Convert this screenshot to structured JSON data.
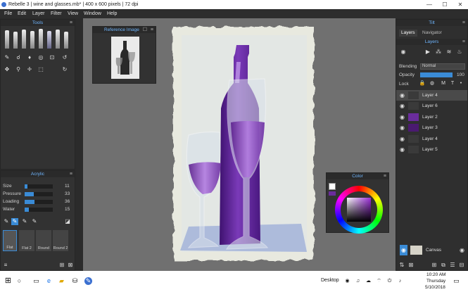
{
  "window": {
    "title": "Rebelle 3 | wine and glasses.mb* | 400 x 600 pixels | 72 dpi",
    "minimize": "—",
    "maximize": "☐",
    "close": "✕"
  },
  "menu": [
    "File",
    "Edit",
    "Layer",
    "Filter",
    "View",
    "Window",
    "Help"
  ],
  "tools_panel": {
    "title": "Tools"
  },
  "reference_panel": {
    "title": "Reference Image"
  },
  "acrylic_panel": {
    "title": "Acrylic",
    "params": [
      {
        "label": "Size",
        "value": "11",
        "level": 0.11
      },
      {
        "label": "Pressure",
        "value": "33",
        "level": 0.33
      },
      {
        "label": "Loading",
        "value": "36",
        "level": 0.36
      },
      {
        "label": "Water",
        "value": "15",
        "level": 0.15
      }
    ],
    "brushes": [
      "Flat",
      "Flat 2",
      "Round",
      "Round 2"
    ]
  },
  "color_panel": {
    "title": "Color"
  },
  "tilt_panel": {
    "title": "Tilt"
  },
  "tabs": [
    "Layers",
    "Navigator"
  ],
  "layers_panel": {
    "title": "Layers",
    "blending_label": "Blending",
    "blending_value": "Normal",
    "opacity_label": "Opacity",
    "opacity_value": "100",
    "lock_label": "Lock",
    "layers": [
      "Layer 4",
      "Layer 6",
      "Layer 2",
      "Layer 3",
      "Layer 4",
      "Layer 5"
    ],
    "canvas_label": "Canvas"
  },
  "taskbar": {
    "desktop": "Desktop",
    "time": "10:20 AM",
    "day": "Thursday",
    "date": "5/10/2018"
  },
  "colors": {
    "accent": "#3a8bd6",
    "panel": "#323232",
    "canvas_bg": "#707070",
    "wine": "#6a2c9c"
  }
}
